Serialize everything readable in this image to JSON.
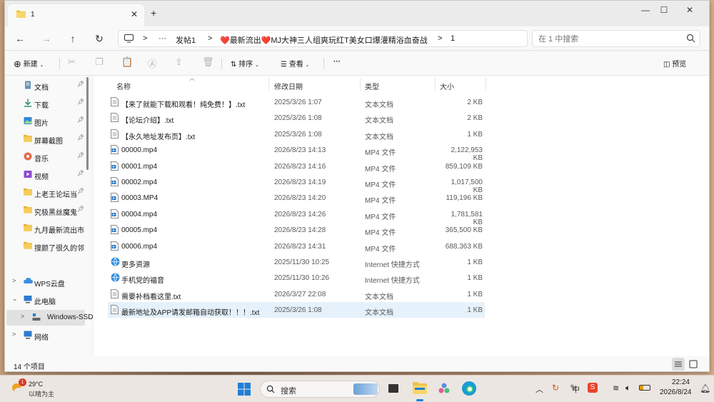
{
  "window": {
    "tab_title": "1",
    "new_tab": "+",
    "minimize": "—",
    "maximize": "☐",
    "close": "✕"
  },
  "address": {
    "more": "···",
    "crumbs": [
      "发帖1",
      "❤️最新流出❤️MJ大神三人组爽玩红T美女口爆灌精浴血奋战",
      "1"
    ],
    "separator": ">",
    "search_placeholder": "在 1 中搜索"
  },
  "toolbar": {
    "new_label": "新建",
    "sort_label": "排序",
    "view_label": "查看",
    "more": "···",
    "preview_label": "预览"
  },
  "sidebar": {
    "quick": [
      {
        "label": "文档",
        "icon": "document-icon"
      },
      {
        "label": "下载",
        "icon": "download-icon"
      },
      {
        "label": "图片",
        "icon": "pictures-icon"
      },
      {
        "label": "屏幕截图",
        "icon": "folder-icon"
      },
      {
        "label": "音乐",
        "icon": "music-icon"
      },
      {
        "label": "视频",
        "icon": "video-icon"
      },
      {
        "label": "上老王论坛当",
        "icon": "folder-icon"
      },
      {
        "label": "究极黑丝魔鬼",
        "icon": "folder-icon"
      },
      {
        "label": "九月最新流出市面",
        "icon": "folder-icon"
      },
      {
        "label": "搜颜了很久的邻居",
        "icon": "folder-icon"
      }
    ],
    "wps": "WPS云盘",
    "this_pc": "此电脑",
    "drive": "Windows-SSD",
    "network": "网络"
  },
  "columns": {
    "name": "名称",
    "date": "修改日期",
    "type": "类型",
    "size": "大小"
  },
  "files": [
    {
      "name": "【来了就能下载和观看！纯免费！】.txt",
      "date": "2025/3/26 1:07",
      "type": "文本文档",
      "size": "2 KB",
      "kind": "txt"
    },
    {
      "name": "【论坛介绍】.txt",
      "date": "2025/3/26 1:08",
      "type": "文本文档",
      "size": "2 KB",
      "kind": "txt"
    },
    {
      "name": "【永久地址发布页】.txt",
      "date": "2025/3/26 1:08",
      "type": "文本文档",
      "size": "1 KB",
      "kind": "txt"
    },
    {
      "name": "00000.mp4",
      "date": "2026/8/23 14:13",
      "type": "MP4 文件",
      "size": "2,122,953 KB",
      "kind": "mp4"
    },
    {
      "name": "00001.mp4",
      "date": "2026/8/23 14:16",
      "type": "MP4 文件",
      "size": "859,109 KB",
      "kind": "mp4"
    },
    {
      "name": "00002.mp4",
      "date": "2026/8/23 14:19",
      "type": "MP4 文件",
      "size": "1,017,500 KB",
      "kind": "mp4"
    },
    {
      "name": "00003.MP4",
      "date": "2026/8/23 14:20",
      "type": "MP4 文件",
      "size": "119,196 KB",
      "kind": "mp4"
    },
    {
      "name": "00004.mp4",
      "date": "2026/8/23 14:26",
      "type": "MP4 文件",
      "size": "1,781,581 KB",
      "kind": "mp4"
    },
    {
      "name": "00005.mp4",
      "date": "2026/8/23 14:28",
      "type": "MP4 文件",
      "size": "365,500 KB",
      "kind": "mp4"
    },
    {
      "name": "00006.mp4",
      "date": "2026/8/23 14:31",
      "type": "MP4 文件",
      "size": "688,363 KB",
      "kind": "mp4"
    },
    {
      "name": "更多资源",
      "date": "2025/11/30 10:25",
      "type": "Internet 快捷方式",
      "size": "1 KB",
      "kind": "url"
    },
    {
      "name": "手机党的福音",
      "date": "2025/11/30 10:26",
      "type": "Internet 快捷方式",
      "size": "1 KB",
      "kind": "url"
    },
    {
      "name": "需要补档看这里.txt",
      "date": "2026/3/27 22:08",
      "type": "文本文档",
      "size": "1 KB",
      "kind": "txt"
    },
    {
      "name": "最新地址及APP请发邮箱自动获取！！！.txt",
      "date": "2025/3/26 1:08",
      "type": "文本文档",
      "size": "1 KB",
      "kind": "txt",
      "selected": true
    }
  ],
  "status": {
    "count": "14 个项目"
  },
  "taskbar": {
    "weather_temp": "29°C",
    "weather_desc": "以晴为主",
    "weather_badge": "1",
    "search_label": "搜索",
    "ime_label": "中",
    "time": "22:24",
    "date": "2026/8/24"
  }
}
